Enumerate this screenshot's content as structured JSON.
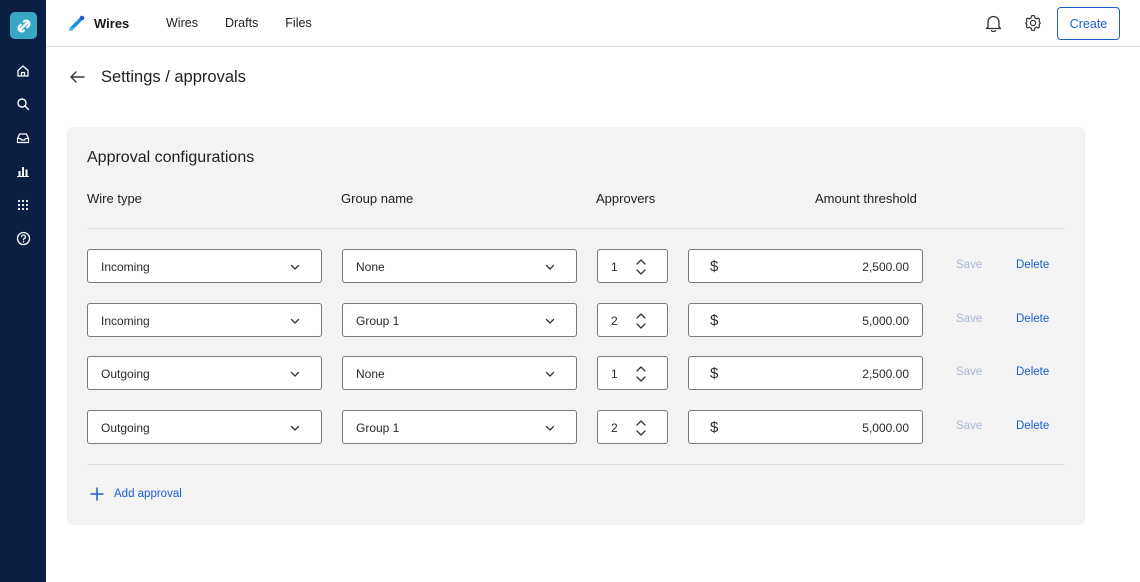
{
  "header": {
    "brand": "Wires",
    "nav": [
      "Wires",
      "Drafts",
      "Files"
    ],
    "create_label": "Create"
  },
  "rail_icons": [
    "home-icon",
    "search-icon",
    "inbox-icon",
    "chart-icon",
    "apps-grid-icon",
    "help-icon"
  ],
  "page": {
    "title": "Settings / approvals"
  },
  "card": {
    "title": "Approval configurations",
    "columns": [
      "Wire type",
      "Group name",
      "Approvers",
      "Amount threshold"
    ],
    "rows": [
      {
        "wire_type": "Incoming",
        "group": "None",
        "approvers": "1",
        "currency": "$",
        "amount": "2,500.00",
        "save": "Save",
        "delete": "Delete"
      },
      {
        "wire_type": "Incoming",
        "group": "Group 1",
        "approvers": "2",
        "currency": "$",
        "amount": "5,000.00",
        "save": "Save",
        "delete": "Delete"
      },
      {
        "wire_type": "Outgoing",
        "group": "None",
        "approvers": "1",
        "currency": "$",
        "amount": "2,500.00",
        "save": "Save",
        "delete": "Delete"
      },
      {
        "wire_type": "Outgoing",
        "group": "Group 1",
        "approvers": "2",
        "currency": "$",
        "amount": "5,000.00",
        "save": "Save",
        "delete": "Delete"
      }
    ],
    "add_label": "Add approval"
  },
  "colors": {
    "rail": "#0b1f44",
    "accent": "#1a5fd0",
    "card": "#f3f3f3",
    "save_disabled": "#aab9d6"
  }
}
